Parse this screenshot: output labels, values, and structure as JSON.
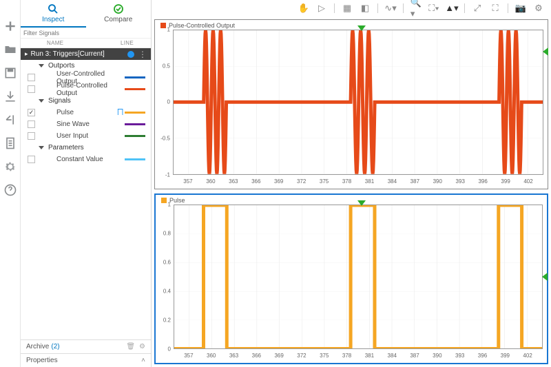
{
  "rail_icons": [
    "plus",
    "folder",
    "save",
    "import",
    "export",
    "page",
    "gear",
    "help"
  ],
  "tabs": {
    "inspect": "Inspect",
    "compare": "Compare"
  },
  "filter_placeholder": "Filter Signals",
  "columns": {
    "name": "NAME",
    "line": "LINE"
  },
  "run_label": "Run 3: Triggers[Current]",
  "groups": {
    "outports": "Outports",
    "signals_label": "Signals",
    "parameters": "Parameters"
  },
  "signals": {
    "user_controlled": {
      "name": "User-Controlled Output",
      "color": "#1565c0",
      "checked": false
    },
    "pulse_controlled": {
      "name": "Pulse-Controlled Output",
      "color": "#e64a19",
      "checked": false
    },
    "pulse": {
      "name": "Pulse",
      "color": "#f5a623",
      "checked": true
    },
    "sine": {
      "name": "Sine Wave",
      "color": "#6a1b9a",
      "checked": false
    },
    "user_input": {
      "name": "User Input",
      "color": "#2e7d32",
      "checked": false
    },
    "constant": {
      "name": "Constant Value",
      "color": "#4fc3f7",
      "checked": false
    }
  },
  "archive": {
    "label": "Archive",
    "count": "(2)"
  },
  "properties_label": "Properties",
  "toolbar_icons": [
    "pan",
    "play",
    "grid",
    "eraser",
    "wave",
    "zoom",
    "fit",
    "cursor",
    "expand",
    "fullscreen",
    "snapshot",
    "settings"
  ],
  "chart_data": [
    {
      "type": "line",
      "title": "Pulse-Controlled Output",
      "color": "#e64a19",
      "xlim": [
        355,
        404
      ],
      "ylim": [
        -1.0,
        1.0
      ],
      "yticks": [
        -1.0,
        -0.5,
        0,
        0.5,
        1.0
      ],
      "xticks": [
        357,
        360,
        363,
        366,
        369,
        372,
        375,
        378,
        381,
        384,
        387,
        390,
        393,
        396,
        399,
        402
      ],
      "bursts": [
        {
          "start": 359.0,
          "end": 362.0
        },
        {
          "start": 378.5,
          "end": 381.7
        },
        {
          "start": 398.2,
          "end": 401.2
        }
      ],
      "cursor_x": 380.0,
      "side_marker_y": 0.7
    },
    {
      "type": "line",
      "title": "Pulse",
      "color": "#f5a623",
      "xlim": [
        355,
        404
      ],
      "ylim": [
        0,
        1.0
      ],
      "yticks": [
        0,
        0.2,
        0.4,
        0.6,
        0.8,
        1.0
      ],
      "xticks": [
        357,
        360,
        363,
        366,
        369,
        372,
        375,
        378,
        381,
        384,
        387,
        390,
        393,
        396,
        399,
        402
      ],
      "pulses": [
        {
          "rise": 358.9,
          "fall": 362.0
        },
        {
          "rise": 378.5,
          "fall": 381.7
        },
        {
          "rise": 398.2,
          "fall": 401.3
        }
      ],
      "cursor_x": 380.0,
      "side_marker_y": 0.5
    }
  ]
}
